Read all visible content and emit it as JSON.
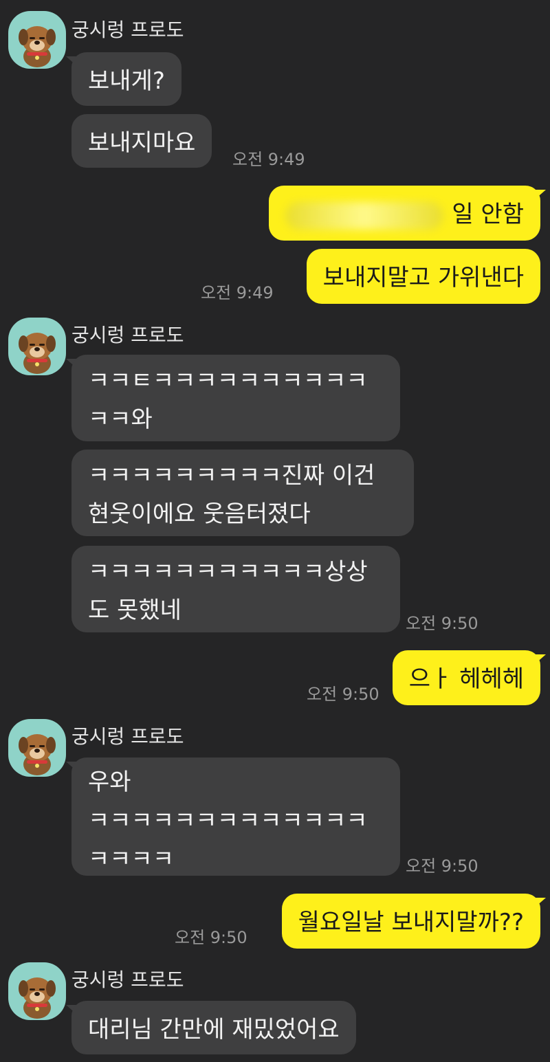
{
  "messages": {
    "m1": {
      "sender": "궁시렁 프로도",
      "text": "보내게?"
    },
    "m2": {
      "text": "보내지마요",
      "time": "오전 9:49"
    },
    "m3": {
      "text": "일 안함"
    },
    "m4": {
      "text": "보내지말고 가위낸다",
      "time": "오전 9:49"
    },
    "m5": {
      "sender": "궁시렁 프로도",
      "line1": "ㅋㅋㅌㅋㅋㅋㅋㅋㅋㅋㅋㅋㅋ",
      "line2": "ㅋㅋ와"
    },
    "m6": {
      "line1": "ㅋㅋㅋㅋㅋㅋㅋㅋㅋ진짜 이건",
      "line2": "현웃이에요 웃음터졌다"
    },
    "m7": {
      "line1": "ㅋㅋㅋㅋㅋㅋㅋㅋㅋㅋㅋ상상",
      "line2": "도 못했네",
      "time": "오전 9:50"
    },
    "m8": {
      "text": "으ㅏ 헤헤헤",
      "time": "오전 9:50"
    },
    "m9": {
      "sender": "궁시렁 프로도",
      "line1": "우와",
      "line2": "ㅋㅋㅋㅋㅋㅋㅋㅋㅋㅋㅋㅋㅋ",
      "line3": "ㅋㅋㅋㅋ",
      "time": "오전 9:50"
    },
    "m10": {
      "text": "월요일날 보내지말까??",
      "time": "오전 9:50"
    },
    "m11": {
      "sender": "궁시렁 프로도",
      "text": "대리님 간만에 재밌었어요"
    }
  },
  "colors": {
    "background": "#252526",
    "incoming_bubble": "#3f3f40",
    "outgoing_bubble": "#fef01b",
    "avatar_bg": "#8fd3c8"
  },
  "icons": {
    "avatar": "frodo-dog-avatar-icon"
  }
}
